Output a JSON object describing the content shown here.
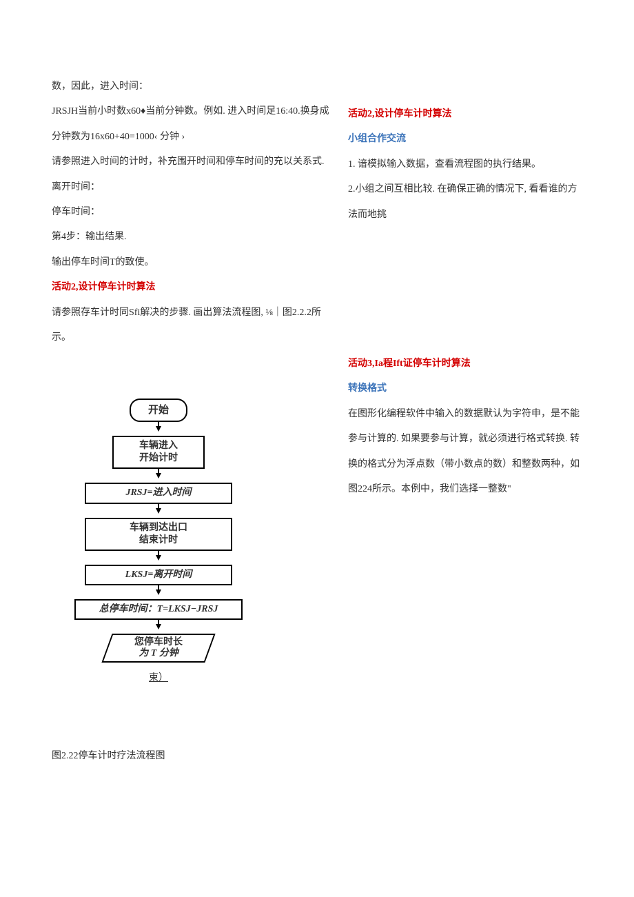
{
  "left": {
    "p1": "数，因此，进入时间：",
    "p2": "JRSJH当前小时数x60♦当前分钟数。例如. 进入时间足16:40.换身成分钟数为16x60+40=1000‹ 分钟 ›",
    "p3": "请参照进入时间的计时，补充围开时间和停车时间的充以关系式.",
    "p4": "离开时间：",
    "p5": "停车时间：",
    "p6": "第4步：输出结果.",
    "p7": "输出停车时间T的致使。",
    "act2_title": "活动2,设计停车计时算法",
    "p8": "请参照存车计时同Sfi解决的步骤. 画出算法流程图, ⅛｜图2.2.2所示。"
  },
  "right1": {
    "act2_title": "活动2,设计停车计时算法",
    "sub": "小组合作交流",
    "p1": "1. 谙模拟输入数据，查看流程图的执行结果。",
    "p2": "2.小组之间互相比较. 在确保正确的情况下, 看看谁的方法而地挑"
  },
  "right2": {
    "act3_title": "活动3,Ia程Ift证停车计时算法",
    "sub": "转换格式",
    "p1": "在图形化编程软件中输入的数据默认为字符申，是不能参与计算的. 如果要参与计算，就必须进行格式转换. 转换的格式分为浮点数（带小数点的数）和整数两种，如图224所示。本例中，我们选择一整数\""
  },
  "flow": {
    "start": "开始",
    "b1a": "车辆进入",
    "b1b": "开始计时",
    "b2": "JRSJ=进入时间",
    "b3a": "车辆到达出口",
    "b3b": "结束计时",
    "b4": "LKSJ=离开时间",
    "b5": "总停车时间：T=LKSJ−JRSJ",
    "out1": "您停车时长",
    "out2": "为 T 分钟",
    "shu": "束）"
  },
  "caption": "图2.22停车计时疗法流程图"
}
